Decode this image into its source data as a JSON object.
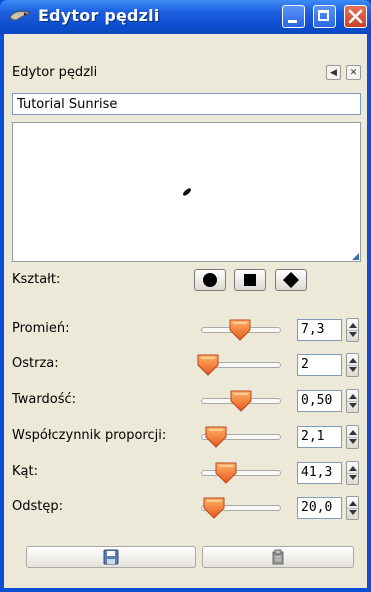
{
  "window": {
    "title": "Edytor pędzli",
    "colors": {
      "title_bar": "#0b4fd6",
      "client_bg": "#ece9d8",
      "slider_thumb": "#f07a3a"
    }
  },
  "panel": {
    "title": "Edytor pędzli",
    "brush_name": "Tutorial Sunrise"
  },
  "shape": {
    "label": "Kształt:",
    "options": [
      "circle",
      "square",
      "diamond"
    ]
  },
  "params": [
    {
      "label": "Promień:",
      "value": "7,3",
      "slider_fraction": 0.49
    },
    {
      "label": "Ostrza:",
      "value": "2",
      "slider_fraction": 0.02
    },
    {
      "label": "Twardość:",
      "value": "0,50",
      "slider_fraction": 0.5
    },
    {
      "label": "Współczynnik proporcji:",
      "value": "2,1",
      "slider_fraction": 0.13
    },
    {
      "label": "Kąt:",
      "value": "41,3",
      "slider_fraction": 0.28
    },
    {
      "label": "Odstęp:",
      "value": "20,0",
      "slider_fraction": 0.1
    }
  ],
  "icons": {
    "title": "gimp-wilber-icon",
    "panel_menu": "panel-menu-icon",
    "panel_close": "panel-close-icon",
    "save": "save-icon",
    "revert": "revert-icon"
  }
}
